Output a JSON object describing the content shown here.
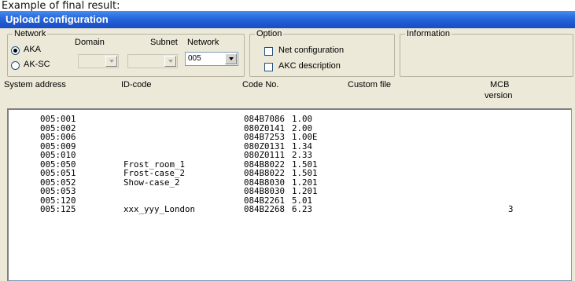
{
  "caption": "Example of final result:",
  "window": {
    "title": "Upload configuration"
  },
  "network_group": {
    "legend": "Network",
    "radio_aka": "AKA",
    "radio_aksc": "AK-SC",
    "domain_label": "Domain",
    "subnet_label": "Subnet",
    "network_label": "Network",
    "network_value": "005"
  },
  "option_group": {
    "legend": "Option",
    "net_configuration": "Net configuration",
    "akc_description": "AKC description"
  },
  "information_group": {
    "legend": "Information"
  },
  "columns": {
    "system_address": "System address",
    "id_code": "ID-code",
    "code_no": "Code No.",
    "custom_file": "Custom file",
    "mcb": "MCB",
    "version": "version"
  },
  "rows": [
    {
      "address": "005:001",
      "id": "",
      "code": "084B7086",
      "ver": "1.00",
      "mcb": ""
    },
    {
      "address": "005:002",
      "id": "",
      "code": "080Z0141",
      "ver": "2.00",
      "mcb": ""
    },
    {
      "address": "005:006",
      "id": "",
      "code": "084B7253",
      "ver": "1.00E",
      "mcb": ""
    },
    {
      "address": "005:009",
      "id": "",
      "code": "080Z0131",
      "ver": "1.34",
      "mcb": ""
    },
    {
      "address": "005:010",
      "id": "",
      "code": "080Z0111",
      "ver": "2.33",
      "mcb": ""
    },
    {
      "address": "005:050",
      "id": "Frost_room_1",
      "code": "084B8022",
      "ver": "1.501",
      "mcb": ""
    },
    {
      "address": "005:051",
      "id": "Frost-case_2",
      "code": "084B8022",
      "ver": "1.501",
      "mcb": ""
    },
    {
      "address": "005:052",
      "id": "Show-case_2",
      "code": "084B8030",
      "ver": "1.201",
      "mcb": ""
    },
    {
      "address": "005:053",
      "id": "",
      "code": "084B8030",
      "ver": "1.201",
      "mcb": ""
    },
    {
      "address": "005:120",
      "id": "",
      "code": "084B2261",
      "ver": "5.01",
      "mcb": ""
    },
    {
      "address": "005:125",
      "id": "xxx_yyy_London",
      "code": "084B2268",
      "ver": "6.23",
      "mcb": "3"
    }
  ],
  "colors": {
    "titlebar": "#1e58d0",
    "window_bg": "#ece9d8"
  }
}
